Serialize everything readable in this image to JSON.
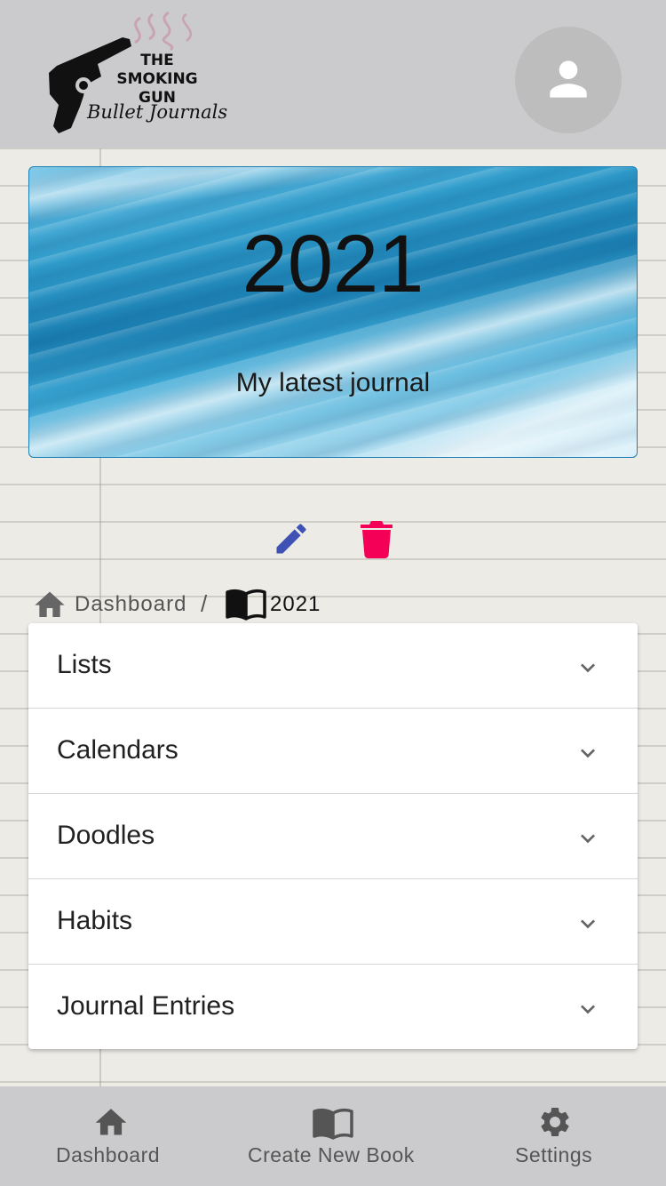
{
  "header": {
    "logo": {
      "line1": "THE",
      "line2": "SMOKING",
      "line3": "GUN",
      "script": "Bullet Journals"
    },
    "avatar_icon": "person-icon"
  },
  "cover": {
    "title": "2021",
    "subtitle": "My latest journal"
  },
  "actions": {
    "edit_icon": "pencil-icon",
    "delete_icon": "trash-icon",
    "edit_color": "#3f51b5",
    "delete_color": "#f50057"
  },
  "breadcrumb": {
    "home_label": "Dashboard",
    "separator": "/",
    "current": "2021"
  },
  "sections": [
    {
      "label": "Lists"
    },
    {
      "label": "Calendars"
    },
    {
      "label": "Doodles"
    },
    {
      "label": "Habits"
    },
    {
      "label": "Journal Entries"
    }
  ],
  "bottom_nav": [
    {
      "label": "Dashboard",
      "icon": "home-icon"
    },
    {
      "label": "Create New Book",
      "icon": "book-icon"
    },
    {
      "label": "Settings",
      "icon": "gear-icon"
    }
  ]
}
